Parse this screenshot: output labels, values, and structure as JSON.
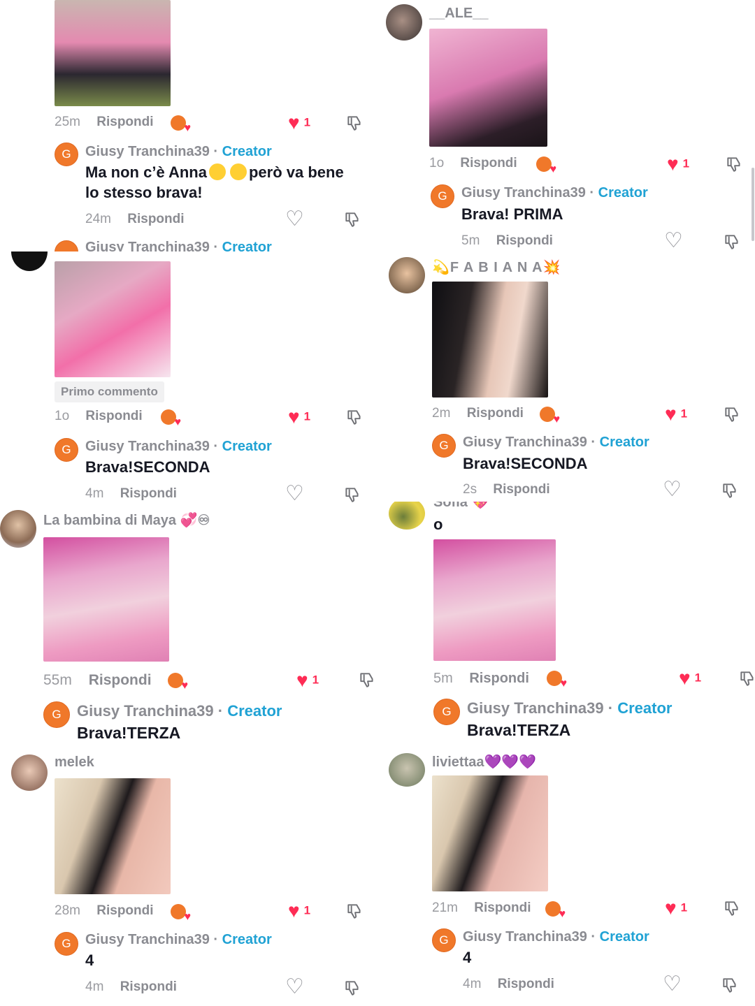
{
  "actions": {
    "reply": "Rispondi",
    "like_count": "1"
  },
  "reply_author": {
    "name": "Giusy Tranchina39",
    "sep": " · ",
    "badge": "Creator",
    "avatar_letter": "G"
  },
  "tiles": [
    {
      "time": "25m",
      "reply_time": "24m",
      "reply_text_1": "Ma non c’è Anna",
      "reply_text_2": "però va bene",
      "reply_text_3": "lo stesso brava!"
    },
    {
      "user": "__ALE__",
      "time": "1o",
      "reply_time": "5m",
      "reply_text": "Brava! PRIMA"
    },
    {
      "pill": "Primo commento",
      "time": "1o",
      "reply_time": "4m",
      "reply_text": "Brava!SECONDA"
    },
    {
      "user": "💫F A B I A N A💥",
      "time": "2m",
      "reply_time": "2s",
      "reply_text": "Brava!SECONDA"
    },
    {
      "user": "La bambina di Maya 💞♾",
      "time": "55m",
      "reply_text": "Brava!TERZA"
    },
    {
      "user_partial": "Sofia 💖",
      "caption": "o",
      "time": "5m",
      "reply_text": "Brava!TERZA"
    },
    {
      "user": "melek",
      "time": "28m",
      "reply_time": "4m",
      "reply_text": "4"
    },
    {
      "user": "liviettaa💜💜💜",
      "time": "21m",
      "reply_time": "4m",
      "reply_text": "4"
    }
  ],
  "colors": {
    "like": "#fe2c55",
    "creator": "#20a2d4",
    "avatar": "#f0782a",
    "muted": "#8a8b91"
  }
}
